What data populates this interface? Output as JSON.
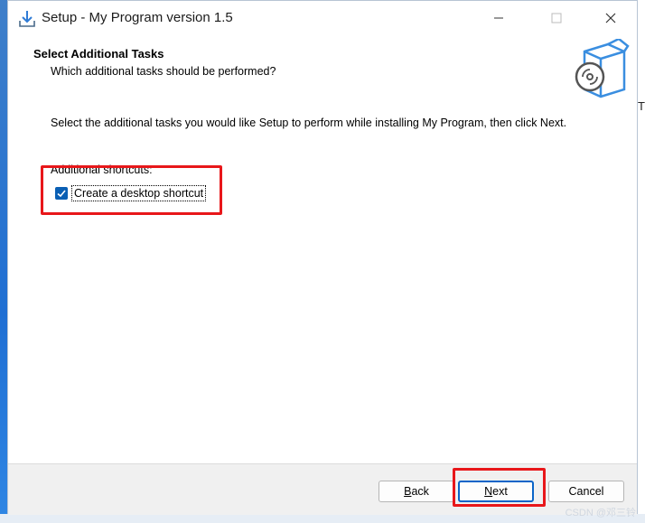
{
  "window": {
    "title": "Setup - My Program version 1.5",
    "title_icon": "install-download-icon"
  },
  "header": {
    "title": "Select Additional Tasks",
    "subtitle": "Which additional tasks should be performed?",
    "image": "software-box-disc-icon"
  },
  "content": {
    "instruction": "Select the additional tasks you would like Setup to perform while installing My Program, then click Next.",
    "group_label": "Additional shortcuts:",
    "tasks": [
      {
        "label": "Create a desktop shortcut",
        "checked": true
      }
    ]
  },
  "buttons": {
    "back": {
      "accel": "B",
      "rest": "ack"
    },
    "next": {
      "accel": "N",
      "rest": "ext"
    },
    "cancel": "Cancel"
  },
  "background_text": "T",
  "watermark": "CSDN @邓三铃",
  "colors": {
    "annotation": "#e8171a",
    "checkbox": "#0a5fb4",
    "default_button_border": "#0a64c8"
  }
}
